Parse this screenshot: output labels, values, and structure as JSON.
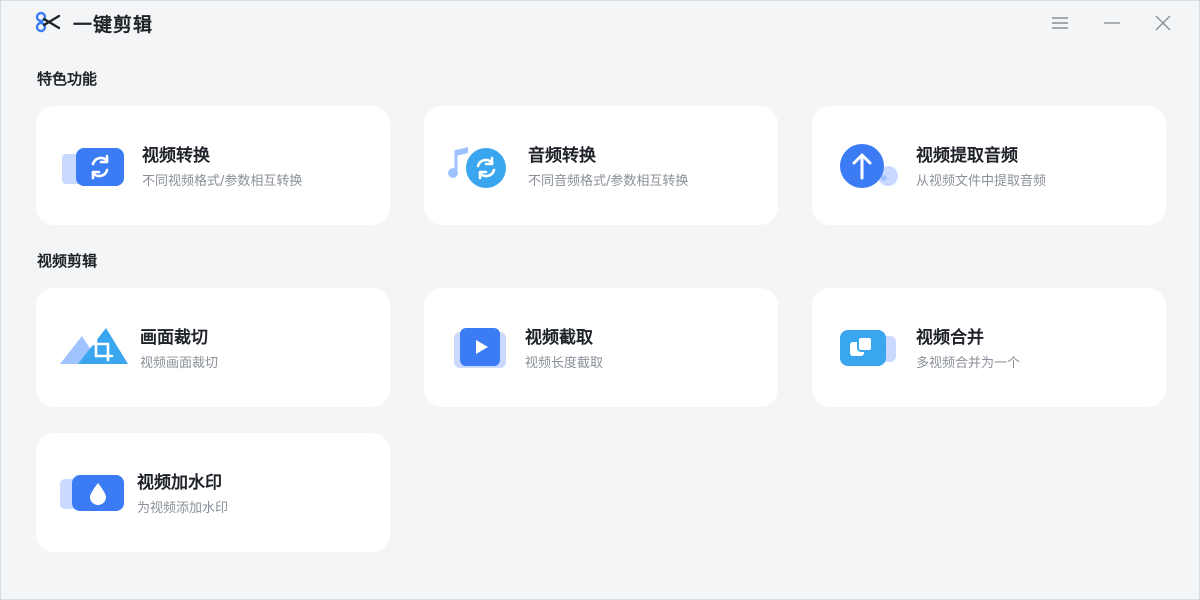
{
  "app": {
    "title": "一键剪辑"
  },
  "sections": {
    "features": {
      "title": "特色功能"
    },
    "video_edit": {
      "title": "视频剪辑"
    }
  },
  "cards": [
    {
      "title": "视频转换",
      "desc": "不同视频格式/参数相互转换",
      "icon": "video-convert-icon"
    },
    {
      "title": "音频转换",
      "desc": "不同音频格式/参数相互转换",
      "icon": "audio-convert-icon"
    },
    {
      "title": "视频提取音频",
      "desc": "从视频文件中提取音频",
      "icon": "extract-audio-icon"
    },
    {
      "title": "画面裁切",
      "desc": "视频画面裁切",
      "icon": "crop-icon"
    },
    {
      "title": "视频截取",
      "desc": "视频长度截取",
      "icon": "video-trim-icon"
    },
    {
      "title": "视频合并",
      "desc": "多视频合并为一个",
      "icon": "video-merge-icon"
    },
    {
      "title": "视频加水印",
      "desc": "为视频添加水印",
      "icon": "watermark-icon"
    }
  ],
  "colors": {
    "accent": "#3b7cf5",
    "accent_light": "#9ec3ff",
    "background": "#f4f5f7",
    "card": "#ffffff"
  }
}
